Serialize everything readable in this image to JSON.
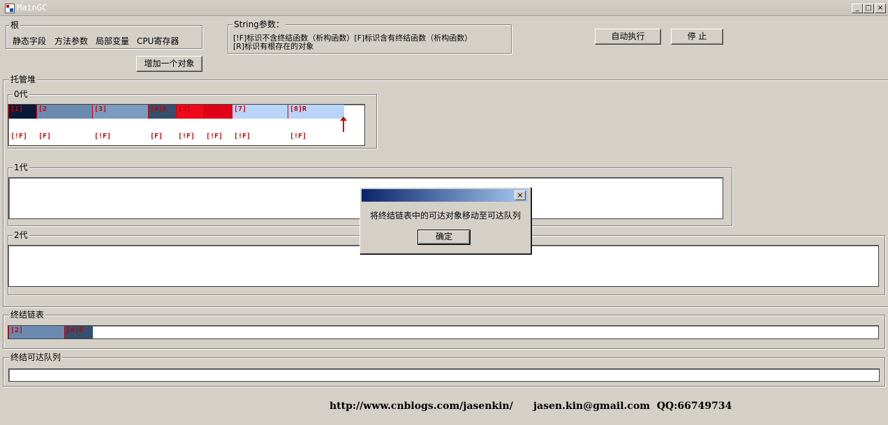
{
  "window": {
    "title": "MainGC",
    "minimize": "_",
    "maximize": "□",
    "close": "×"
  },
  "roots": {
    "legend": "根",
    "items": [
      "静态字段",
      "方法参数",
      "局部变量",
      "CPU寄存器"
    ],
    "add_button": "增加一个对象"
  },
  "string_params": {
    "legend": "String参数：",
    "line1": "[!F]标识不含终结函数（析构函数）[F]标识含有终结函数（析构函数）",
    "line2": "[R]标识有根存在的对象"
  },
  "controls": {
    "auto_run": "自动执行",
    "stop": "停 止"
  },
  "managed_heap": {
    "legend": "托管堆",
    "gen0": {
      "legend": "0代",
      "blocks": [
        {
          "label": "[1]",
          "tag": "[!F]",
          "color": "#0a1a3a"
        },
        {
          "label": "[2",
          "tag": "[F]",
          "color": "#6a8ab0"
        },
        {
          "label": "[3]",
          "tag": "[!F]",
          "color": "#7a9ac0"
        },
        {
          "label": "[4]R",
          "tag": "[F]",
          "color": "#33506e"
        },
        {
          "label": "[5]",
          "tag": "[!F]",
          "color": "#ee0a1a"
        },
        {
          "label": "[6]",
          "tag": "[!F]",
          "color": "#e0001a"
        },
        {
          "label": "[7]",
          "tag": "[!F]",
          "color": "#b8d4f8"
        },
        {
          "label": "[8]R",
          "tag": "[!F]",
          "color": "#b8d4f8"
        }
      ]
    },
    "gen1": {
      "legend": "1代"
    },
    "gen2": {
      "legend": "2代"
    }
  },
  "finalization_list": {
    "legend": "终结链表",
    "blocks": [
      {
        "label": "[2]",
        "color": "#6a8ab0"
      },
      {
        "label": "[4]R",
        "color": "#33506e"
      }
    ]
  },
  "freachable_queue": {
    "legend": "终结可达队列"
  },
  "footer": {
    "text": "http://www.cnblogs.com/jasenkin/      jasen.kin@gmail.com  QQ:66749734"
  },
  "dialog": {
    "message": "将终结链表中的可达对象移动至可达队列",
    "ok": "确定",
    "close": "×"
  }
}
